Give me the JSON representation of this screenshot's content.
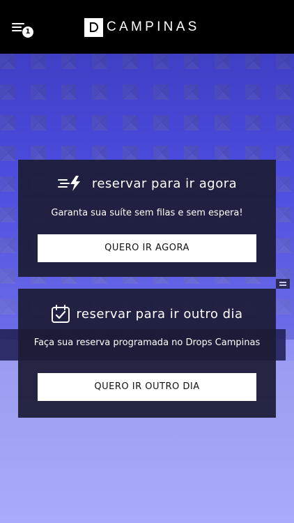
{
  "header": {
    "badge_count": "1",
    "logo_text": "CAMPINAS"
  },
  "cards": [
    {
      "title": "reservar para ir agora",
      "subtitle": "Garanta sua suíte sem filas e sem espera!",
      "button_label": "QUERO IR AGORA",
      "icon": "lightning-speed-icon"
    },
    {
      "title": "reservar para ir outro dia",
      "subtitle": "Faça sua reserva programada no Drops Campinas",
      "button_label": "QUERO IR OUTRO DIA",
      "icon": "calendar-check-icon"
    }
  ],
  "colors": {
    "header_bg": "#000000",
    "card_bg": "#1c1c36",
    "button_bg": "#ffffff",
    "accent_blue": "#5a5ae6"
  }
}
